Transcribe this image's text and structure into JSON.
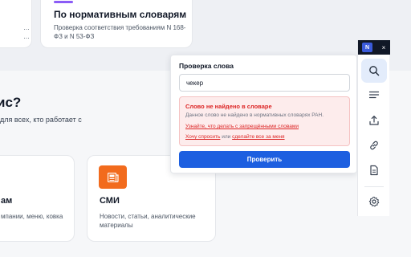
{
  "background": {
    "top_left_card": {
      "desc": "…\n…"
    },
    "top_mid_card": {
      "title": "По нормативным словарям",
      "desc": "Проверка соответствия требованиям N 168-ФЗ и N 53-ФЗ"
    },
    "heading": "ис?",
    "subtext": "для всех, кто работает с",
    "bottom_left_card": {
      "title": "ам",
      "desc": "мпании, меню, ковка"
    },
    "bottom_mid_card": {
      "title": "СМИ",
      "desc": "Новости, статьи, аналитические материалы",
      "icon": "newspaper-icon"
    }
  },
  "popup": {
    "title": "Проверка слова",
    "input_value": "чекер",
    "error": {
      "title": "Слово не найдено в словаре",
      "description": "Данное слово не найдено в нормативных словарях РАН.",
      "link_forbidden": "Узнайте, что делать с запрещёнными словами",
      "link_ask": "Хочу спросить",
      "separator": "или",
      "link_do_all": "сделайте все за меня"
    },
    "check_button": "Проверить"
  },
  "side_panel": {
    "logo_letter": "N",
    "close_label": "×",
    "tools": [
      {
        "name": "search-icon"
      },
      {
        "name": "list-icon"
      },
      {
        "name": "upload-icon"
      },
      {
        "name": "link-icon"
      },
      {
        "name": "document-icon"
      },
      {
        "name": "gear-icon"
      }
    ]
  },
  "colors": {
    "accent": "#1d5fe0",
    "error": "#dc2626",
    "error_bg": "#fdecec",
    "smi_icon": "#f26b1d",
    "logo": "#3b5bdb"
  }
}
